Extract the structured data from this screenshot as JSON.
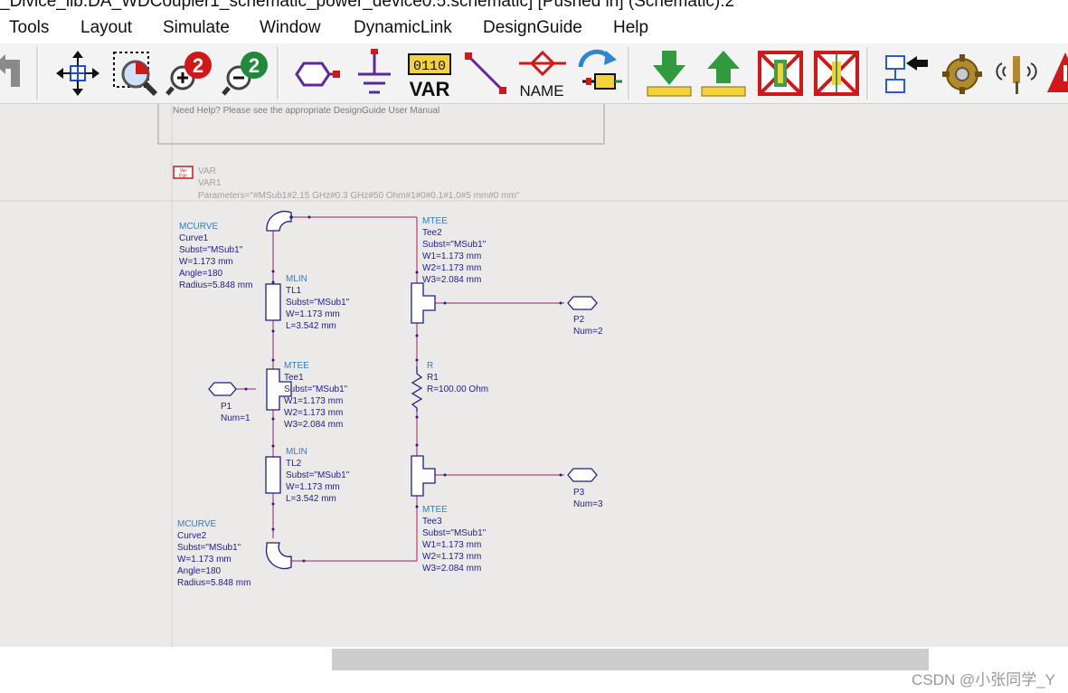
{
  "window": {
    "title": "_Divice_lib:DA_WDCoupler1_schematic_power_device0.5:schematic] [Pushed in] (Schematic):2"
  },
  "menu": [
    "Tools",
    "Layout",
    "Simulate",
    "Window",
    "DynamicLink",
    "DesignGuide",
    "Help"
  ],
  "toolbar": {
    "var_label": "VAR",
    "var_digits": "0110",
    "name_label": "NAME",
    "zoom2_label": "2",
    "buttons": [
      "rotate-icon",
      "move-icon",
      "zoom-area-icon",
      "zoom-in-2x-icon",
      "zoom-out-2x-icon",
      "port-icon",
      "ground-icon",
      "var-icon",
      "wire-icon",
      "name-icon",
      "simulate-icon",
      "push-in-icon",
      "pop-out-icon",
      "deactivate-icon",
      "deactivate-short-icon",
      "hierarchy-icon",
      "gear-icon",
      "tuning-icon",
      "alert-icon"
    ]
  },
  "designguide": {
    "help_text": "Need Help?  Please see the appropriate DesignGuide User Manual"
  },
  "var_block": {
    "icon_text_1": "Var",
    "icon_text_2": "Eqn",
    "type": "VAR",
    "name": "VAR1",
    "params": "Parameters=\"#MSub1#2.15 GHz#0.3 GHz#50 Ohm#1#0#0.1#1.0#5 mm#0 mm\""
  },
  "components": {
    "curve1": [
      "MCURVE",
      "Curve1",
      "Subst=\"MSub1\"",
      "W=1.173 mm",
      "Angle=180",
      "Radius=5.848 mm"
    ],
    "tl1": [
      "MLIN",
      "TL1",
      "Subst=\"MSub1\"",
      "W=1.173 mm",
      "L=3.542 mm"
    ],
    "tee1": [
      "MTEE",
      "Tee1",
      "Subst=\"MSub1\"",
      "W1=1.173 mm",
      "W2=1.173 mm",
      "W3=2.084 mm"
    ],
    "tl2": [
      "MLIN",
      "TL2",
      "Subst=\"MSub1\"",
      "W=1.173 mm",
      "L=3.542 mm"
    ],
    "curve2": [
      "MCURVE",
      "Curve2",
      "Subst=\"MSub1\"",
      "W=1.173 mm",
      "Angle=180",
      "Radius=5.848 mm"
    ],
    "tee2": [
      "MTEE",
      "Tee2",
      "Subst=\"MSub1\"",
      "W1=1.173 mm",
      "W2=1.173 mm",
      "W3=2.084 mm"
    ],
    "r1": [
      "R",
      "R1",
      "R=100.00 Ohm"
    ],
    "tee3": [
      "MTEE",
      "Tee3",
      "Subst=\"MSub1\"",
      "W1=1.173 mm",
      "W2=1.173 mm",
      "W3=2.084 mm"
    ],
    "p1": [
      "P1",
      "Num=1"
    ],
    "p2": [
      "P2",
      "Num=2"
    ],
    "p3": [
      "P3",
      "Num=3"
    ]
  },
  "status": {
    "watermark": "CSDN @小张同学_Y"
  },
  "colors": {
    "label_type": "#2c7fd0",
    "label_text": "#1e1e8c",
    "wire": "#a0206a",
    "component": "#1e1e8c",
    "grid_line": "#d6d3d3"
  }
}
